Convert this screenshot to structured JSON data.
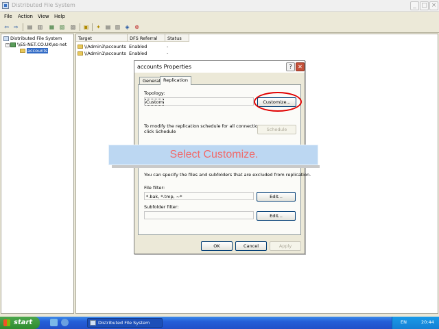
{
  "window": {
    "title": "Distributed File System"
  },
  "menubar": {
    "items": [
      "File",
      "Action",
      "View",
      "Help"
    ]
  },
  "tree": {
    "root": "Distributed File System",
    "domain": "\\\\ES-NET.CO.UK\\es-net",
    "child": "accounts"
  },
  "list": {
    "columns": [
      "Target",
      "DFS Referral",
      "Status"
    ],
    "rows": [
      {
        "target": "\\\\Admin3\\accounts",
        "referral": "Enabled",
        "status": "-"
      },
      {
        "target": "\\\\Admin1\\accounts",
        "referral": "Enabled",
        "status": "-"
      }
    ]
  },
  "dialog": {
    "title": "accounts Properties",
    "help_btn": "?",
    "close_btn": "✕",
    "tabs": [
      "General",
      "Replication"
    ],
    "topology_label": "Topology:",
    "topology_value": "Custom",
    "customize_btn": "Customize...",
    "schedule_text_1": "To modify the replication schedule for all connections,",
    "schedule_text_2": "click Schedule",
    "schedule_btn": "Schedule",
    "exclude_text": "You can specify the files and subfolders that are excluded from replication.",
    "file_filter_label": "File filter:",
    "file_filter_value": "*.bak, *.tmp, ~*",
    "file_edit_btn": "Edit...",
    "subfolder_filter_label": "Subfolder filter:",
    "subfolder_filter_value": "",
    "subfolder_edit_btn": "Edit...",
    "ok_btn": "OK",
    "cancel_btn": "Cancel",
    "apply_btn": "Apply"
  },
  "callout": {
    "text": "Select Customize."
  },
  "taskbar": {
    "start": "start",
    "task": "Distributed File System",
    "lang": "EN",
    "clock": "20:44"
  },
  "colors": {
    "highlight_ring": "#e00000",
    "callout_text": "#f06a6a",
    "callout_bg": "#bcd7f2"
  }
}
